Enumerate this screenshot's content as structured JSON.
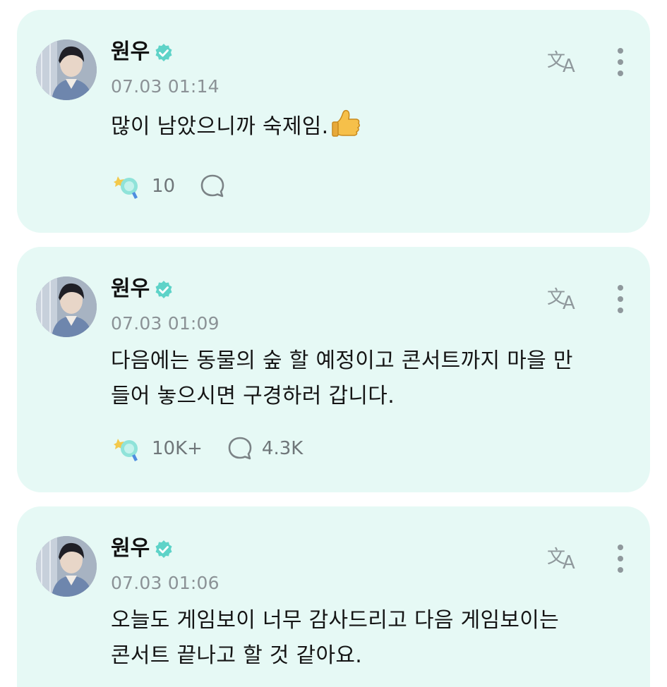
{
  "posts": [
    {
      "author": "원우",
      "time": "07.03 01:14",
      "lines": [
        "많이 남았으니까 숙제임."
      ],
      "emoji": "thumbs-up",
      "reactions": "10",
      "comments": ""
    },
    {
      "author": "원우",
      "time": "07.03 01:09",
      "lines": [
        "다음에는 동물의 숲 할 예정이고 콘서트까지 마을 만",
        "들어 놓으시면 구경하러 갑니다."
      ],
      "reactions": "10K+",
      "comments": "4.3K"
    },
    {
      "author": "원우",
      "time": "07.03 01:06",
      "lines": [
        "오늘도 게임보이 너무 감사드리고 다음 게임보이는",
        "콘서트 끝나고 할 것 같아요."
      ]
    }
  ],
  "colors": {
    "card_background": "#e6f9f5",
    "accent_mint": "#5ed3c8",
    "muted_text": "#8b9296"
  },
  "icons": {
    "verified": "verified-badge-icon",
    "translate": "translate-icon",
    "more": "more-vertical-icon",
    "reaction": "reaction-light-stick-icon",
    "comment": "comment-bubble-icon"
  }
}
